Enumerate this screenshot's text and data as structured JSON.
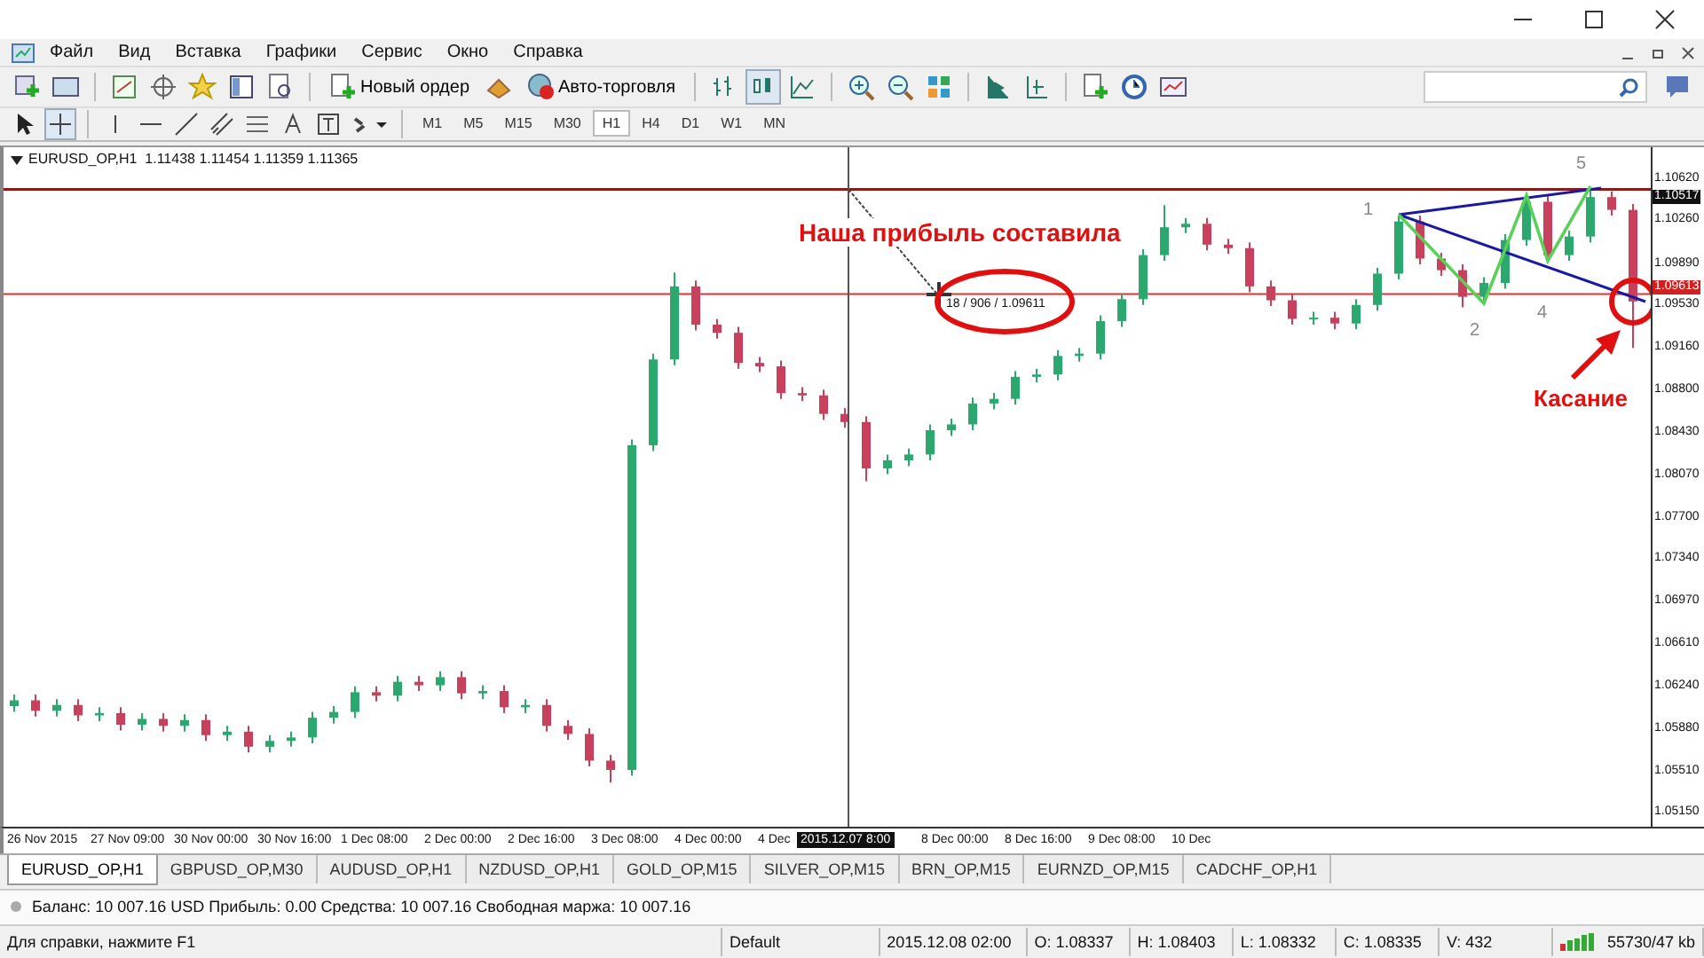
{
  "menu": [
    "Файл",
    "Вид",
    "Вставка",
    "Графики",
    "Сервис",
    "Окно",
    "Справка"
  ],
  "toolbar": {
    "new_order": "Новый ордер",
    "auto_trading": "Авто-торговля"
  },
  "timeframes": [
    {
      "label": "M1",
      "selected": false
    },
    {
      "label": "M5",
      "selected": false
    },
    {
      "label": "M15",
      "selected": false
    },
    {
      "label": "M30",
      "selected": false
    },
    {
      "label": "H1",
      "selected": true
    },
    {
      "label": "H4",
      "selected": false
    },
    {
      "label": "D1",
      "selected": false
    },
    {
      "label": "W1",
      "selected": false
    },
    {
      "label": "MN",
      "selected": false
    }
  ],
  "chart": {
    "header": "EURUSD_OP,H1  1.11438 1.11454 1.11359 1.11365",
    "chart_data": {
      "type": "candlestick",
      "ylim": [
        1.0502,
        1.1088
      ],
      "yticks": [
        {
          "value": 1.1062,
          "label": "1.10620"
        },
        {
          "value": 1.1026,
          "label": "1.10260"
        },
        {
          "value": 1.0989,
          "label": "1.09890"
        },
        {
          "value": 1.0953,
          "label": "1.09530"
        },
        {
          "value": 1.0916,
          "label": "1.09160"
        },
        {
          "value": 1.088,
          "label": "1.08800"
        },
        {
          "value": 1.0843,
          "label": "1.08430"
        },
        {
          "value": 1.0807,
          "label": "1.08070"
        },
        {
          "value": 1.077,
          "label": "1.07700"
        },
        {
          "value": 1.0734,
          "label": "1.07340"
        },
        {
          "value": 1.0697,
          "label": "1.06970"
        },
        {
          "value": 1.0661,
          "label": "1.06610"
        },
        {
          "value": 1.0624,
          "label": "1.06240"
        },
        {
          "value": 1.0588,
          "label": "1.05880"
        },
        {
          "value": 1.0551,
          "label": "1.05510"
        },
        {
          "value": 1.0515,
          "label": "1.05150"
        }
      ],
      "ohlc": [
        [
          1.0606,
          1.0616,
          1.0601,
          1.0611
        ],
        [
          1.0611,
          1.0616,
          1.0597,
          1.0602
        ],
        [
          1.0602,
          1.0612,
          1.0597,
          1.0607
        ],
        [
          1.0607,
          1.0612,
          1.0593,
          1.0598
        ],
        [
          1.0598,
          1.0605,
          1.0593,
          1.06
        ],
        [
          1.06,
          1.0605,
          1.0585,
          1.059
        ],
        [
          1.059,
          1.06,
          1.0585,
          1.0595
        ],
        [
          1.0595,
          1.06,
          1.0584,
          1.0589
        ],
        [
          1.0589,
          1.0599,
          1.0584,
          1.0594
        ],
        [
          1.0594,
          1.0599,
          1.0576,
          1.0581
        ],
        [
          1.0581,
          1.0589,
          1.0576,
          1.0584
        ],
        [
          1.0584,
          1.0589,
          1.0566,
          1.0571
        ],
        [
          1.0571,
          1.0581,
          1.0566,
          1.0576
        ],
        [
          1.0576,
          1.0584,
          1.0571,
          1.0579
        ],
        [
          1.0579,
          1.0601,
          1.0574,
          1.0596
        ],
        [
          1.0596,
          1.0606,
          1.0591,
          1.0601
        ],
        [
          1.0601,
          1.0623,
          1.0596,
          1.0618
        ],
        [
          1.0618,
          1.0623,
          1.061,
          1.0615
        ],
        [
          1.0615,
          1.0632,
          1.061,
          1.0627
        ],
        [
          1.0627,
          1.0632,
          1.0619,
          1.0624
        ],
        [
          1.0624,
          1.0636,
          1.0619,
          1.0631
        ],
        [
          1.0631,
          1.0636,
          1.0612,
          1.0617
        ],
        [
          1.0617,
          1.0624,
          1.0612,
          1.0619
        ],
        [
          1.0619,
          1.0624,
          1.06,
          1.0605
        ],
        [
          1.0605,
          1.0612,
          1.06,
          1.0607
        ],
        [
          1.0607,
          1.0612,
          1.0584,
          1.0589
        ],
        [
          1.0589,
          1.0594,
          1.0577,
          1.0582
        ],
        [
          1.0582,
          1.0587,
          1.0554,
          1.0559
        ],
        [
          1.0559,
          1.0564,
          1.054,
          1.0551
        ],
        [
          1.0551,
          1.0836,
          1.0546,
          1.0831
        ],
        [
          1.0831,
          1.091,
          1.0826,
          1.0905
        ],
        [
          1.0905,
          1.098,
          1.09,
          1.0968
        ],
        [
          1.0968,
          1.0973,
          1.093,
          1.0935
        ],
        [
          1.0935,
          1.094,
          1.0923,
          1.0928
        ],
        [
          1.0928,
          1.0933,
          1.0897,
          1.0902
        ],
        [
          1.0902,
          1.0907,
          1.0894,
          1.0899
        ],
        [
          1.0899,
          1.0904,
          1.0871,
          1.0876
        ],
        [
          1.0876,
          1.0881,
          1.0869,
          1.0874
        ],
        [
          1.0874,
          1.0879,
          1.0853,
          1.0858
        ],
        [
          1.0858,
          1.0863,
          1.0846,
          1.0851
        ],
        [
          1.0851,
          1.0856,
          1.08,
          1.0811
        ],
        [
          1.0811,
          1.0823,
          1.0806,
          1.0818
        ],
        [
          1.0818,
          1.0828,
          1.0813,
          1.0823
        ],
        [
          1.0823,
          1.0849,
          1.0818,
          1.0844
        ],
        [
          1.0844,
          1.0854,
          1.0839,
          1.0849
        ],
        [
          1.0849,
          1.0872,
          1.0844,
          1.0867
        ],
        [
          1.0867,
          1.0876,
          1.0862,
          1.0871
        ],
        [
          1.0871,
          1.0895,
          1.0866,
          1.089
        ],
        [
          1.089,
          1.0897,
          1.0885,
          1.0892
        ],
        [
          1.0892,
          1.0913,
          1.0887,
          1.0908
        ],
        [
          1.0908,
          1.0915,
          1.0903,
          1.091
        ],
        [
          1.091,
          1.0943,
          1.0905,
          1.0938
        ],
        [
          1.0938,
          1.0962,
          1.0933,
          1.0957
        ],
        [
          1.0957,
          1.1,
          1.0952,
          1.0995
        ],
        [
          1.0995,
          1.1038,
          1.099,
          1.1019
        ],
        [
          1.1019,
          1.1027,
          1.1014,
          1.1022
        ],
        [
          1.1022,
          1.1027,
          1.0999,
          1.1004
        ],
        [
          1.1004,
          1.1009,
          1.0996,
          1.1001
        ],
        [
          1.1001,
          1.1006,
          1.0963,
          1.0968
        ],
        [
          1.0968,
          1.0973,
          1.0951,
          1.0956
        ],
        [
          1.0956,
          1.0961,
          1.0935,
          1.094
        ],
        [
          1.094,
          1.0946,
          1.0935,
          1.0941
        ],
        [
          1.0941,
          1.0946,
          1.0931,
          1.0936
        ],
        [
          1.0936,
          1.0957,
          1.0931,
          1.0952
        ],
        [
          1.0952,
          1.0984,
          1.0947,
          1.0979
        ],
        [
          1.0979,
          1.1029,
          1.0974,
          1.1024
        ],
        [
          1.1024,
          1.1029,
          1.0987,
          1.0992
        ],
        [
          1.0992,
          1.0997,
          1.0977,
          1.0982
        ],
        [
          1.0982,
          1.0987,
          1.095,
          1.0959
        ],
        [
          1.0959,
          1.0976,
          1.0954,
          1.0971
        ],
        [
          1.0971,
          1.1013,
          1.0966,
          1.1008
        ],
        [
          1.1008,
          1.1046,
          1.1003,
          1.1041
        ],
        [
          1.1041,
          1.1046,
          1.099,
          1.0995
        ],
        [
          1.0995,
          1.1016,
          1.099,
          1.1011
        ],
        [
          1.1011,
          1.1053,
          1.1006,
          1.1045
        ],
        [
          1.1045,
          1.105,
          1.1029,
          1.1034
        ],
        [
          1.1034,
          1.1039,
          1.0915,
          1.0955
        ]
      ]
    },
    "price_tags": [
      {
        "text": "1.10517",
        "kind": "line"
      },
      {
        "text": "1.09613",
        "kind": "alert"
      }
    ],
    "time_labels": [
      "26 Nov 2015",
      "27 Nov 09:00",
      "30 Nov 00:00",
      "30 Nov 16:00",
      "1 Dec 08:00",
      "2 Dec 00:00",
      "2 Dec 16:00",
      "3 Dec 08:00",
      "4 Dec 00:00",
      "4 Dec"
    ],
    "time_labels_right": [
      "8 Dec 00:00",
      "8 Dec 16:00",
      "9 Dec 08:00",
      "10 Dec"
    ],
    "cursor_time": "2015.12.07 8:00",
    "crosshair_readout": "18 / 906 / 1.09611",
    "profit_caption": "Наша прибыль составила",
    "touch_caption": "Касание",
    "wave_labels": [
      "1",
      "2",
      "4",
      "5"
    ]
  },
  "tabs": [
    {
      "label": "EURUSD_OP,H1",
      "selected": true
    },
    {
      "label": "GBPUSD_OP,M30",
      "selected": false
    },
    {
      "label": "AUDUSD_OP,H1",
      "selected": false
    },
    {
      "label": "NZDUSD_OP,H1",
      "selected": false
    },
    {
      "label": "GOLD_OP,M15",
      "selected": false
    },
    {
      "label": "SILVER_OP,M15",
      "selected": false
    },
    {
      "label": "BRN_OP,M15",
      "selected": false
    },
    {
      "label": "EURNZD_OP,M15",
      "selected": false
    },
    {
      "label": "CADCHF_OP,H1",
      "selected": false
    }
  ],
  "account": "Баланс: 10 007.16 USD  Прибыль: 0.00  Средства: 10 007.16  Свободная маржа: 10 007.16",
  "status_bar": {
    "help": "Для справки, нажмите F1",
    "profile": "Default",
    "time": "2015.12.08 02:00",
    "open": "O: 1.08337",
    "high": "H: 1.08403",
    "low": "L: 1.08332",
    "close": "C: 1.08335",
    "volume": "V: 432",
    "traffic": "55730/47 kb"
  }
}
